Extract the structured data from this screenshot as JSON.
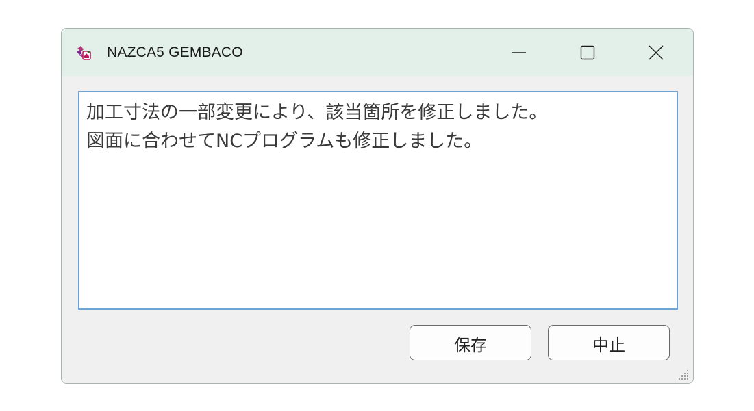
{
  "window": {
    "title": "NAZCA5 GEMBACO",
    "app_icon": "nazca-app-icon",
    "titlebar_color": "#e3f0ea",
    "controls": [
      "minimize-icon",
      "maximize-icon",
      "close-icon"
    ]
  },
  "memo": {
    "lines": [
      "加工寸法の一部変更により、該当箇所を修正しました。",
      "図面に合わせてNCプログラムも修正しました。"
    ],
    "border_color": "#6ea2d4"
  },
  "buttons": {
    "save_label": "保存",
    "cancel_label": "中止"
  }
}
